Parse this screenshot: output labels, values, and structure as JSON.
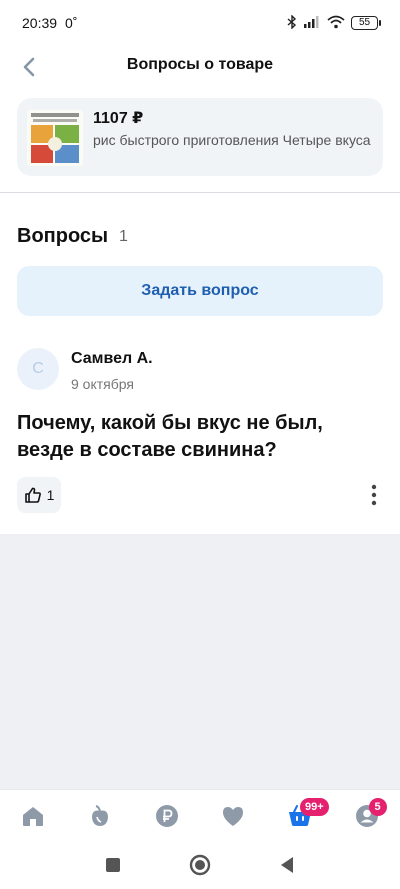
{
  "status_bar": {
    "time": "20:39",
    "temp": "0˚",
    "battery": "55"
  },
  "header": {
    "title": "Вопросы о товаре"
  },
  "product": {
    "price": "1107 ₽",
    "name": "рис быстрого приготовления Четыре вкуса"
  },
  "questions_section": {
    "title": "Вопросы",
    "count": "1",
    "ask_button_label": "Задать вопрос"
  },
  "question": {
    "avatar_letter": "С",
    "author": "Самвел А.",
    "date": "9 октября",
    "text": "Почему, какой бы вкус не был, везде в составе свинина?",
    "likes": "1"
  },
  "bottom_nav": {
    "items": [
      {
        "icon": "home-icon"
      },
      {
        "icon": "catalog-icon"
      },
      {
        "icon": "ruble-icon"
      },
      {
        "icon": "heart-icon"
      },
      {
        "icon": "cart-icon",
        "badge": "99+"
      },
      {
        "icon": "profile-icon",
        "badge": "5"
      }
    ]
  },
  "colors": {
    "accent": "#1f5fb0",
    "nav_icon": "#8e9aa8",
    "cart_active": "#1a73e8",
    "badge": "#e5216f"
  }
}
